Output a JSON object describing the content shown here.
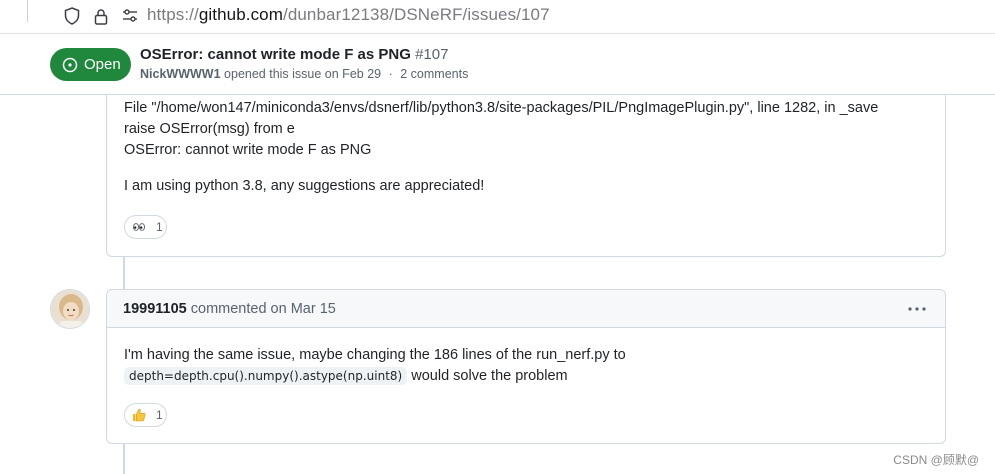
{
  "browser": {
    "url_scheme": "https://",
    "url_host": "github.com",
    "url_path": "/dunbar12138/DSNeRF/issues/107",
    "icons": [
      "shield-icon",
      "lock-icon",
      "permissions-icon"
    ]
  },
  "issue": {
    "state": "Open",
    "title": "OSError: cannot write mode F as PNG",
    "number": "#107",
    "author": "NickWWWW1",
    "opened_text": "opened this issue on Feb 29",
    "separator": "·",
    "comments_count": "2 comments",
    "state_color": "#1f883d"
  },
  "comments": [
    {
      "traceback_line": "File \"/home/won147/miniconda3/envs/dsnerf/lib/python3.8/site-packages/PIL/PngImagePlugin.py\", line 1282, in _save",
      "raise_line": "raise OSError(msg) from e",
      "error_line": "OSError: cannot write mode F as PNG",
      "paragraph": "I am using python 3.8, any suggestions are appreciated!",
      "reaction": {
        "emoji": "eyes-icon",
        "count": "1"
      }
    },
    {
      "author": "19991105",
      "when": "commented on Mar 15",
      "text_before": "I'm having the same issue, maybe changing the 186 lines of the run_nerf.py to",
      "code": "depth=depth.cpu().numpy().astype(np.uint8)",
      "text_after": "would solve the problem",
      "reaction": {
        "emoji": "thumbs-up-icon",
        "count": "1"
      }
    }
  ],
  "watermark": "CSDN @顾默@"
}
